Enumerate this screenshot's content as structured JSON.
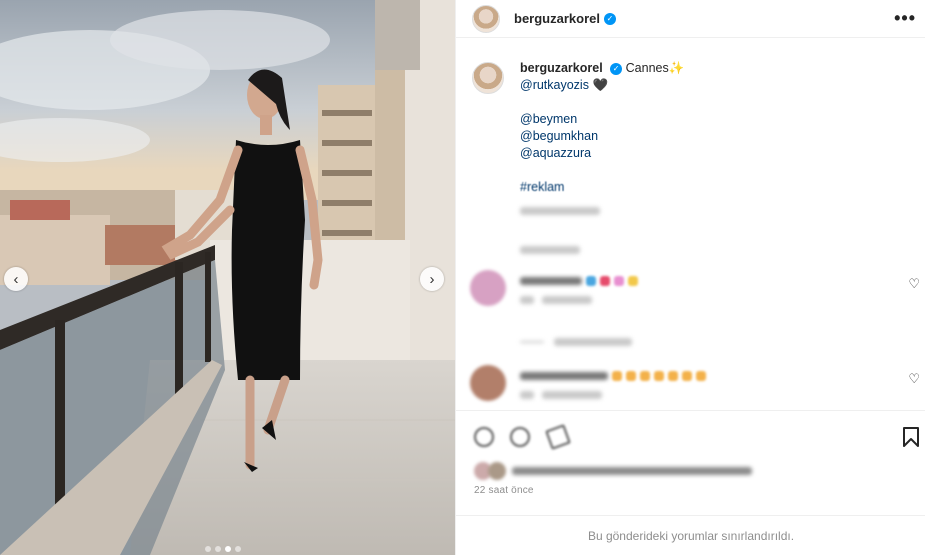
{
  "post": {
    "username": "berguzarkorel",
    "more_label": "•••",
    "verified_glyph": "✓",
    "carousel": {
      "prev_icon": "‹",
      "next_icon": "›",
      "slides": 4,
      "active_slide": 3
    }
  },
  "caption": {
    "username": "berguzarkorel",
    "title": "Cannes✨",
    "mention_line": "@rutkayozis",
    "heart": "🖤",
    "brands": [
      "@beymen",
      "@begumkhan",
      "@aquazzura"
    ],
    "hashtag": "#reklam"
  },
  "comments": [
    {
      "avatar_color": "#d7a1c3",
      "emojis": [
        "#4aa6e0",
        "#e64b6b",
        "#e88fd0",
        "#f2c84a"
      ]
    },
    {
      "avatar_color": "#b27f6a",
      "emojis": [
        "#f3b14a",
        "#f3b14a",
        "#f3b14a",
        "#f3b14a",
        "#f3b14a",
        "#f3b14a",
        "#f3b14a"
      ]
    }
  ],
  "timestamp": "22 saat önce",
  "footer": "Bu gönderideki yorumlar sınırlandırıldı."
}
